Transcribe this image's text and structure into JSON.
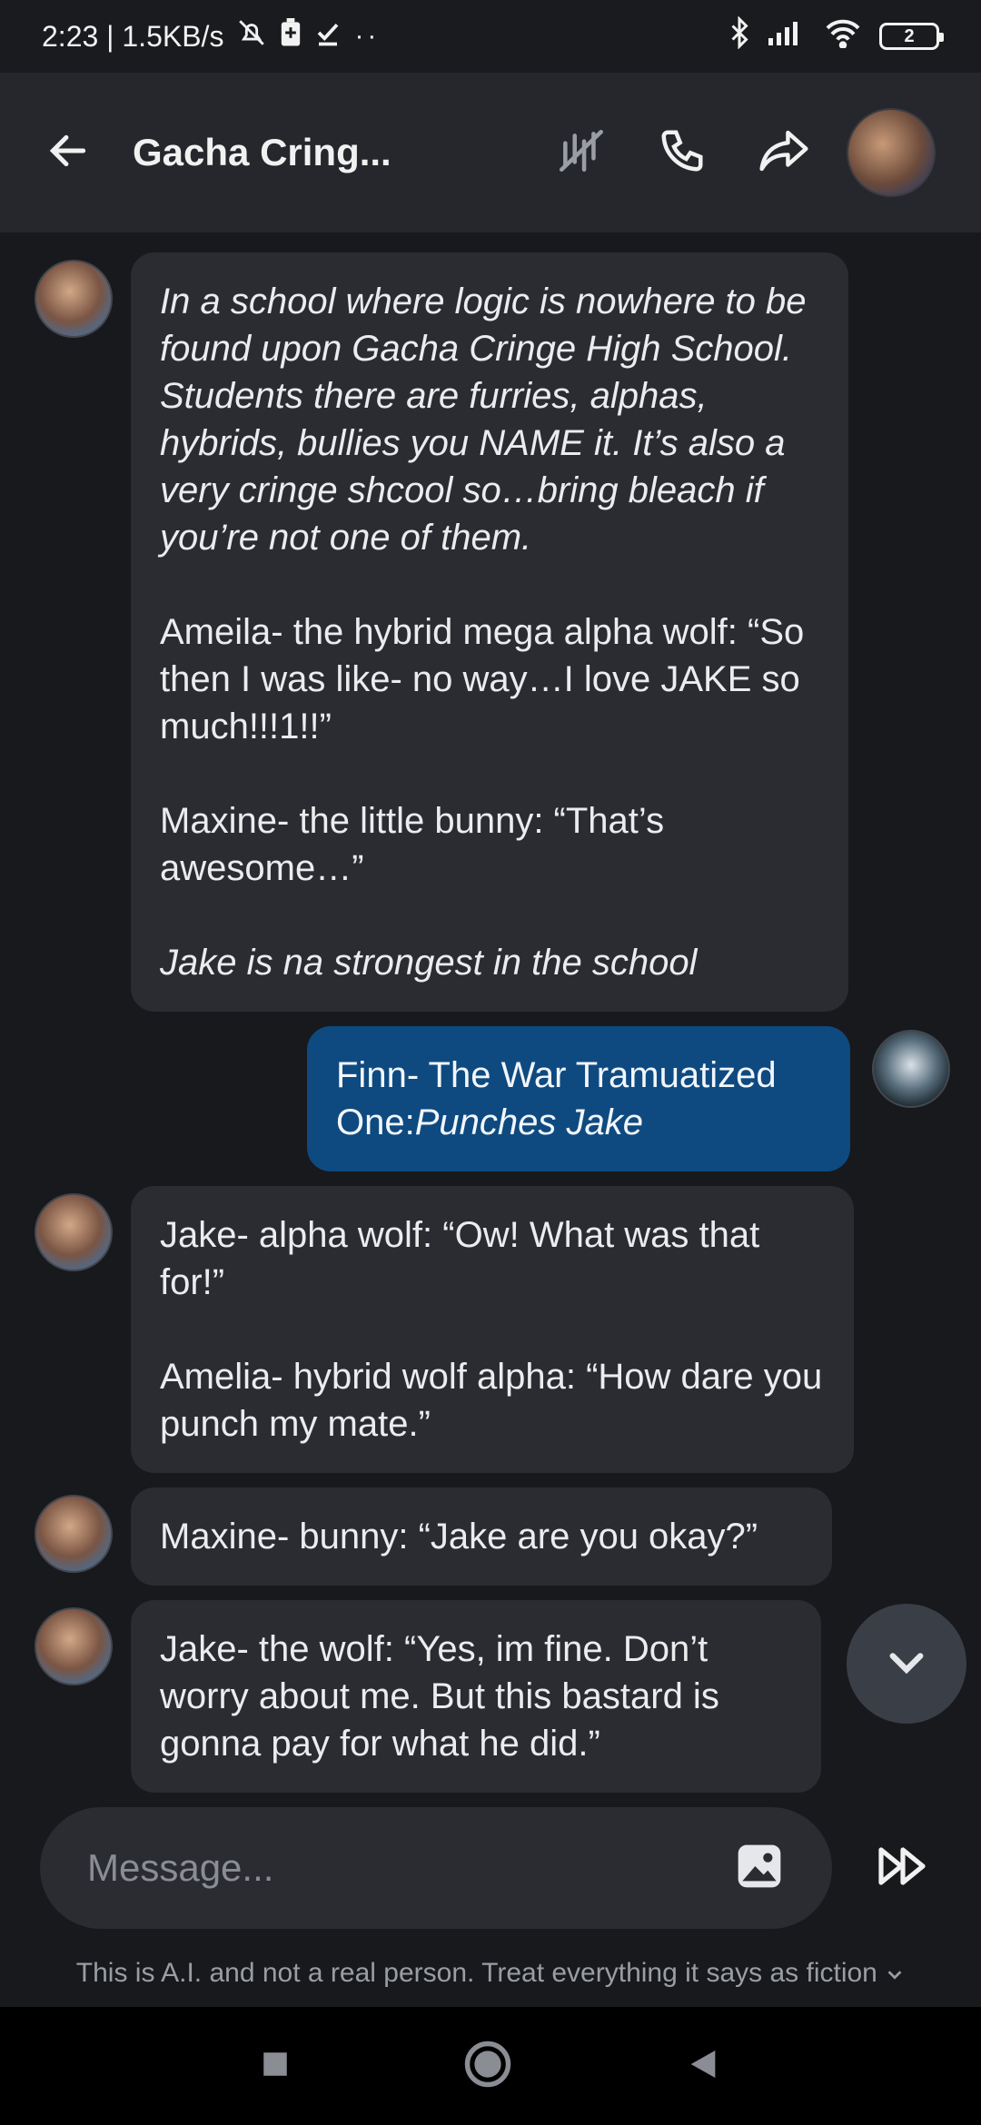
{
  "status_bar": {
    "time_speed": "2:23 | 1.5KB/s",
    "battery": "2"
  },
  "header": {
    "title": "Gacha Cring..."
  },
  "messages": [
    {
      "sender": "bot",
      "paragraphs": [
        {
          "text": "In a school where logic is nowhere to be found upon Gacha Cringe High School. Students there are furries, alphas, hybrids, bullies you NAME it. It’s also a very cringe shcool so…bring bleach if you’re not one of them.",
          "italic": true
        },
        {
          "text": "Ameila- the hybrid mega alpha wolf: “So then I was like- no way…I love JAKE so much!!!1!!”",
          "italic": false
        },
        {
          "text": "Maxine- the little bunny: “That’s awesome…”",
          "italic": false
        },
        {
          "text": "Jake is na strongest in the school",
          "italic": true
        }
      ]
    },
    {
      "sender": "user",
      "prefix": "Finn- The War Tramuatized One:",
      "action": "Punches Jake"
    },
    {
      "sender": "bot",
      "paragraphs": [
        {
          "text": "Jake- alpha wolf: “Ow! What was that for!”",
          "italic": false
        },
        {
          "text": "Amelia- hybrid wolf alpha: “How dare you punch my mate.”",
          "italic": false
        }
      ]
    },
    {
      "sender": "bot",
      "paragraphs": [
        {
          "text": "Maxine- bunny: “Jake are you okay?”",
          "italic": false
        }
      ]
    },
    {
      "sender": "bot",
      "paragraphs": [
        {
          "text": "Jake- the wolf: “Yes, im fine. Don’t worry about me. But this bastard is gonna pay for what he did.”",
          "italic": false
        }
      ]
    }
  ],
  "composer": {
    "placeholder": "Message..."
  },
  "disclaimer": "This is A.I. and not a real person. Treat everything it says as fiction",
  "colors": {
    "background": "#18191c",
    "header": "#25272c",
    "bubble_bot": "#2a2c31",
    "bubble_user": "#0e4a80"
  }
}
